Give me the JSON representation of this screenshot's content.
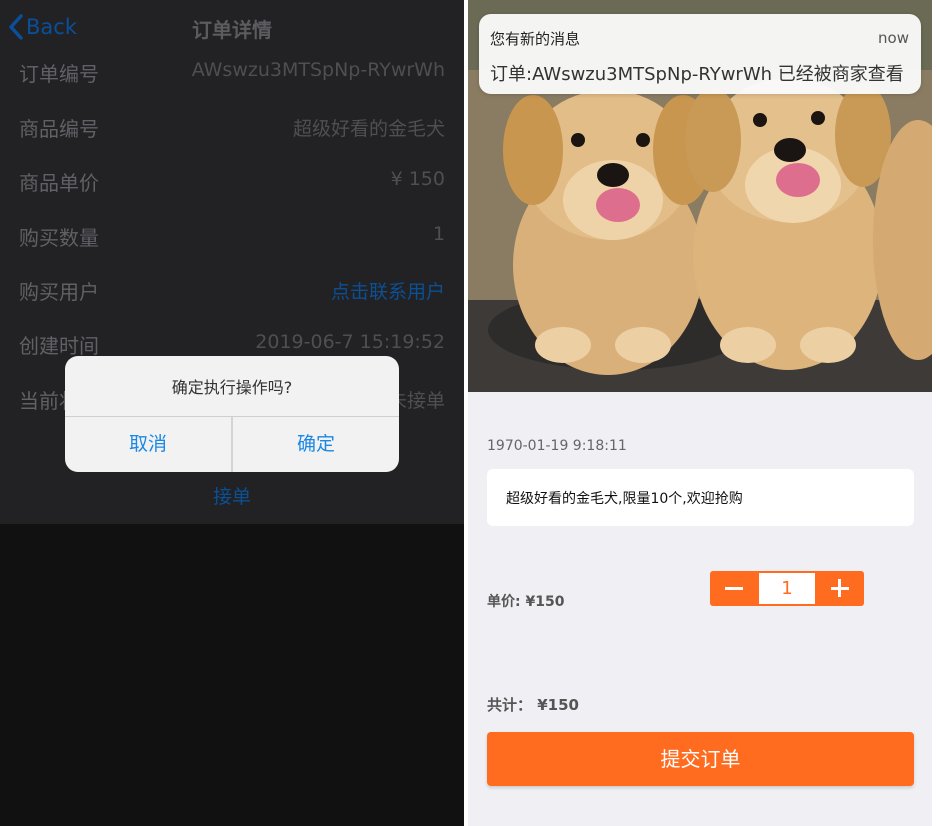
{
  "order_screen": {
    "nav": {
      "back_label": "Back",
      "title": "订单详情"
    },
    "rows": [
      {
        "label": "订单编号",
        "value": "AWswzu3MTSpNp-RYwrWh"
      },
      {
        "label": "商品编号",
        "value": "超级好看的金毛犬"
      },
      {
        "label": "商品单价",
        "value": "¥ 150"
      },
      {
        "label": "购买数量",
        "value": "1"
      },
      {
        "label": "购买用户",
        "value": "点击联系用户"
      },
      {
        "label": "创建时间",
        "value": "2019-06-7 15:19:52"
      },
      {
        "label": "当前状态",
        "value": "未接单"
      }
    ],
    "accept_label": "接单",
    "alert": {
      "message": "确定执行操作吗?",
      "cancel_label": "取消",
      "confirm_label": "确定"
    }
  },
  "product_screen": {
    "notification": {
      "title": "您有新的消息",
      "time": "now",
      "body": "订单:AWswzu3MTSpNp-RYwrWh 已经被商家查看"
    },
    "date": "1970-01-19 9:18:11",
    "description": "超级好看的金毛犬,限量10个,欢迎抢购",
    "unit_price_label": "单价: ¥150",
    "quantity": "1",
    "total_label": "共计： ¥150",
    "submit_label": "提交订单",
    "colors": {
      "accent": "#ff6c1f",
      "link_blue": "#1b88e3"
    }
  }
}
